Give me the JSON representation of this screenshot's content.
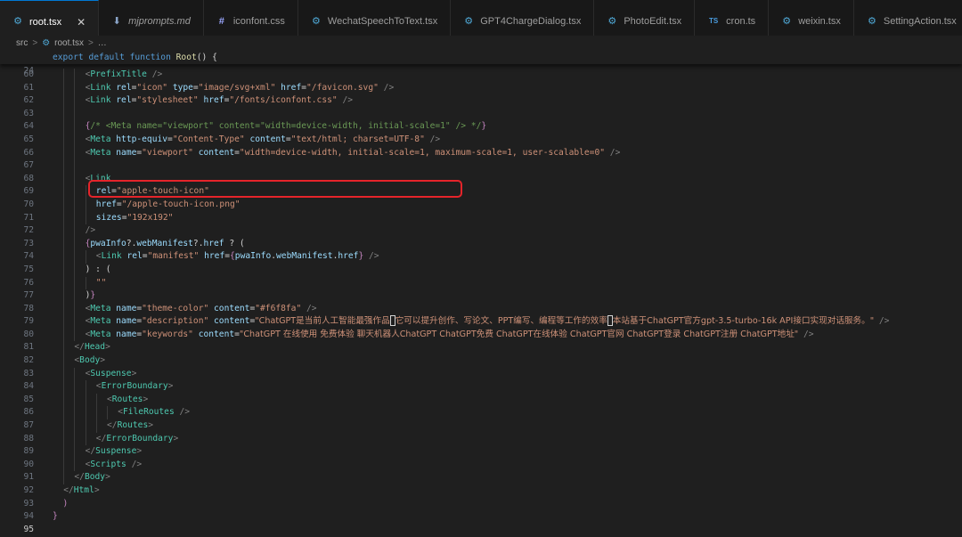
{
  "tabs": [
    {
      "label": "root.tsx",
      "icon": "react-gear-icon",
      "active": true
    },
    {
      "label": "mjprompts.md",
      "icon": "markdown-icon",
      "active": false,
      "italic": true
    },
    {
      "label": "iconfont.css",
      "icon": "css-hash-icon",
      "active": false
    },
    {
      "label": "WechatSpeechToText.tsx",
      "icon": "react-gear-icon",
      "active": false
    },
    {
      "label": "GPT4ChargeDialog.tsx",
      "icon": "react-gear-icon",
      "active": false
    },
    {
      "label": "PhotoEdit.tsx",
      "icon": "react-gear-icon",
      "active": false
    },
    {
      "label": "cron.ts",
      "icon": "typescript-icon",
      "active": false
    },
    {
      "label": "weixin.tsx",
      "icon": "react-gear-icon",
      "active": false
    },
    {
      "label": "SettingAction.tsx",
      "icon": "react-gear-icon",
      "active": false
    }
  ],
  "tab_icon_glyphs": {
    "react-gear-icon": "⚙",
    "markdown-icon": "⬇",
    "css-hash-icon": "#",
    "typescript-icon": "TS"
  },
  "tab_close_glyph": "✕",
  "breadcrumb": {
    "folder": "src",
    "file": "root.tsx",
    "ellipsis": "…",
    "separator": ">"
  },
  "sticky": {
    "line_number": "24",
    "tokens": [
      [
        "kw",
        "export"
      ],
      [
        "punct",
        " "
      ],
      [
        "kw",
        "default"
      ],
      [
        "punct",
        " "
      ],
      [
        "kw",
        "function"
      ],
      [
        "punct",
        " "
      ],
      [
        "fn",
        "Root"
      ],
      [
        "punct",
        "() {"
      ]
    ]
  },
  "current_line": "95",
  "highlighted_line": "65",
  "lines": [
    {
      "n": "60",
      "indent": 3,
      "tokens": [
        [
          "brk",
          "<"
        ],
        [
          "tag",
          "PrefixTitle"
        ],
        [
          "punct",
          " "
        ],
        [
          "brk",
          "/>"
        ]
      ]
    },
    {
      "n": "61",
      "indent": 3,
      "tokens": [
        [
          "brk",
          "<"
        ],
        [
          "tag",
          "Link"
        ],
        [
          "punct",
          " "
        ],
        [
          "attr",
          "rel"
        ],
        [
          "punct",
          "="
        ],
        [
          "str",
          "\"icon\""
        ],
        [
          "punct",
          " "
        ],
        [
          "attr",
          "type"
        ],
        [
          "punct",
          "="
        ],
        [
          "str",
          "\"image/svg+xml\""
        ],
        [
          "punct",
          " "
        ],
        [
          "attr",
          "href"
        ],
        [
          "punct",
          "="
        ],
        [
          "str",
          "\"/favicon.svg\""
        ],
        [
          "punct",
          " "
        ],
        [
          "brk",
          "/>"
        ]
      ]
    },
    {
      "n": "62",
      "indent": 3,
      "tokens": [
        [
          "brk",
          "<"
        ],
        [
          "tag",
          "Link"
        ],
        [
          "punct",
          " "
        ],
        [
          "attr",
          "rel"
        ],
        [
          "punct",
          "="
        ],
        [
          "str",
          "\"stylesheet\""
        ],
        [
          "punct",
          " "
        ],
        [
          "attr",
          "href"
        ],
        [
          "punct",
          "="
        ],
        [
          "str",
          "\"/fonts/iconfont.css\""
        ],
        [
          "punct",
          " "
        ],
        [
          "brk",
          "/>"
        ]
      ]
    },
    {
      "n": "63",
      "indent": 3,
      "tokens": []
    },
    {
      "n": "64",
      "indent": 3,
      "tokens": [
        [
          "ctl",
          "{"
        ],
        [
          "cmt",
          "/* <Meta name=\"viewport\" content=\"width=device-width, initial-scale=1\" /> */"
        ],
        [
          "ctl",
          "}"
        ]
      ]
    },
    {
      "n": "65",
      "indent": 3,
      "tokens": [
        [
          "brk",
          "<"
        ],
        [
          "tag",
          "Meta"
        ],
        [
          "punct",
          " "
        ],
        [
          "attr",
          "http-equiv"
        ],
        [
          "punct",
          "="
        ],
        [
          "str",
          "\"Content-Type\""
        ],
        [
          "punct",
          " "
        ],
        [
          "attr",
          "content"
        ],
        [
          "punct",
          "="
        ],
        [
          "str",
          "\"text/html; charset=UTF-8\""
        ],
        [
          "punct",
          " "
        ],
        [
          "brk",
          "/>"
        ]
      ]
    },
    {
      "n": "66",
      "indent": 3,
      "tokens": [
        [
          "brk",
          "<"
        ],
        [
          "tag",
          "Meta"
        ],
        [
          "punct",
          " "
        ],
        [
          "attr",
          "name"
        ],
        [
          "punct",
          "="
        ],
        [
          "str",
          "\"viewport\""
        ],
        [
          "punct",
          " "
        ],
        [
          "attr",
          "content"
        ],
        [
          "punct",
          "="
        ],
        [
          "str",
          "\"width=device-width, initial-scale=1, maximum-scale=1, user-scalable=0\""
        ],
        [
          "punct",
          " "
        ],
        [
          "brk",
          "/>"
        ]
      ]
    },
    {
      "n": "67",
      "indent": 3,
      "tokens": []
    },
    {
      "n": "68",
      "indent": 3,
      "tokens": [
        [
          "brk",
          "<"
        ],
        [
          "tag",
          "Link"
        ]
      ]
    },
    {
      "n": "69",
      "indent": 4,
      "tokens": [
        [
          "attr",
          "rel"
        ],
        [
          "punct",
          "="
        ],
        [
          "str",
          "\"apple-touch-icon\""
        ]
      ]
    },
    {
      "n": "70",
      "indent": 4,
      "tokens": [
        [
          "attr",
          "href"
        ],
        [
          "punct",
          "="
        ],
        [
          "str",
          "\"/apple-touch-icon.png\""
        ]
      ]
    },
    {
      "n": "71",
      "indent": 4,
      "tokens": [
        [
          "attr",
          "sizes"
        ],
        [
          "punct",
          "="
        ],
        [
          "str",
          "\"192x192\""
        ]
      ]
    },
    {
      "n": "72",
      "indent": 3,
      "tokens": [
        [
          "brk",
          "/>"
        ]
      ]
    },
    {
      "n": "73",
      "indent": 3,
      "tokens": [
        [
          "ctl",
          "{"
        ],
        [
          "var",
          "pwaInfo"
        ],
        [
          "punct",
          "?."
        ],
        [
          "prop",
          "webManifest"
        ],
        [
          "punct",
          "?."
        ],
        [
          "prop",
          "href"
        ],
        [
          "punct",
          " ? ("
        ]
      ]
    },
    {
      "n": "74",
      "indent": 4,
      "tokens": [
        [
          "brk",
          "<"
        ],
        [
          "tag",
          "Link"
        ],
        [
          "punct",
          " "
        ],
        [
          "attr",
          "rel"
        ],
        [
          "punct",
          "="
        ],
        [
          "str",
          "\"manifest\""
        ],
        [
          "punct",
          " "
        ],
        [
          "attr",
          "href"
        ],
        [
          "punct",
          "="
        ],
        [
          "ctl",
          "{"
        ],
        [
          "var",
          "pwaInfo"
        ],
        [
          "punct",
          "."
        ],
        [
          "prop",
          "webManifest"
        ],
        [
          "punct",
          "."
        ],
        [
          "prop",
          "href"
        ],
        [
          "ctl",
          "}"
        ],
        [
          "punct",
          " "
        ],
        [
          "brk",
          "/>"
        ]
      ]
    },
    {
      "n": "75",
      "indent": 3,
      "tokens": [
        [
          "punct",
          ") : ("
        ]
      ]
    },
    {
      "n": "76",
      "indent": 4,
      "tokens": [
        [
          "str",
          "\"\""
        ]
      ]
    },
    {
      "n": "77",
      "indent": 3,
      "tokens": [
        [
          "punct",
          ")"
        ],
        [
          "ctl",
          "}"
        ]
      ]
    },
    {
      "n": "78",
      "indent": 3,
      "tokens": [
        [
          "brk",
          "<"
        ],
        [
          "tag",
          "Meta"
        ],
        [
          "punct",
          " "
        ],
        [
          "attr",
          "name"
        ],
        [
          "punct",
          "="
        ],
        [
          "str",
          "\"theme-color\""
        ],
        [
          "punct",
          " "
        ],
        [
          "attr",
          "content"
        ],
        [
          "punct",
          "="
        ],
        [
          "str",
          "\"#f6f8fa\""
        ],
        [
          "punct",
          " "
        ],
        [
          "brk",
          "/>"
        ]
      ]
    },
    {
      "n": "79",
      "indent": 3,
      "tokens": [
        [
          "brk",
          "<"
        ],
        [
          "tag",
          "Meta"
        ],
        [
          "punct",
          " "
        ],
        [
          "attr",
          "name"
        ],
        [
          "punct",
          "="
        ],
        [
          "str",
          "\"description\""
        ],
        [
          "punct",
          " "
        ],
        [
          "attr",
          "content"
        ],
        [
          "punct",
          "="
        ],
        [
          "str",
          "\"ChatGPT是当前人工智能最强作品"
        ],
        [
          "cur",
          ""
        ],
        [
          "str",
          "它可以提升创作、写论文、PPT编写、编程等工作的效率"
        ],
        [
          "cur",
          ""
        ],
        [
          "str",
          "本站基于ChatGPT官方gpt-3.5-turbo-16k API接口实现对话服务。\""
        ],
        [
          "punct",
          " "
        ],
        [
          "brk",
          "/>"
        ]
      ]
    },
    {
      "n": "80",
      "indent": 3,
      "tokens": [
        [
          "brk",
          "<"
        ],
        [
          "tag",
          "Meta"
        ],
        [
          "punct",
          " "
        ],
        [
          "attr",
          "name"
        ],
        [
          "punct",
          "="
        ],
        [
          "str",
          "\"keywords\""
        ],
        [
          "punct",
          " "
        ],
        [
          "attr",
          "content"
        ],
        [
          "punct",
          "="
        ],
        [
          "str",
          "\"ChatGPT 在线使用 免费体验 聊天机器人ChatGPT ChatGPT免费 ChatGPT在线体验 ChatGPT官网 ChatGPT登录 ChatGPT注册 ChatGPT地址\""
        ],
        [
          "punct",
          " "
        ],
        [
          "brk",
          "/>"
        ]
      ]
    },
    {
      "n": "81",
      "indent": 2,
      "tokens": [
        [
          "brk",
          "</"
        ],
        [
          "tag",
          "Head"
        ],
        [
          "brk",
          ">"
        ]
      ]
    },
    {
      "n": "82",
      "indent": 2,
      "tokens": [
        [
          "brk",
          "<"
        ],
        [
          "tag",
          "Body"
        ],
        [
          "brk",
          ">"
        ]
      ]
    },
    {
      "n": "83",
      "indent": 3,
      "tokens": [
        [
          "brk",
          "<"
        ],
        [
          "tag",
          "Suspense"
        ],
        [
          "brk",
          ">"
        ]
      ]
    },
    {
      "n": "84",
      "indent": 4,
      "tokens": [
        [
          "brk",
          "<"
        ],
        [
          "tag",
          "ErrorBoundary"
        ],
        [
          "brk",
          ">"
        ]
      ]
    },
    {
      "n": "85",
      "indent": 5,
      "tokens": [
        [
          "brk",
          "<"
        ],
        [
          "tag",
          "Routes"
        ],
        [
          "brk",
          ">"
        ]
      ]
    },
    {
      "n": "86",
      "indent": 6,
      "tokens": [
        [
          "brk",
          "<"
        ],
        [
          "tag",
          "FileRoutes"
        ],
        [
          "punct",
          " "
        ],
        [
          "brk",
          "/>"
        ]
      ]
    },
    {
      "n": "87",
      "indent": 5,
      "tokens": [
        [
          "brk",
          "</"
        ],
        [
          "tag",
          "Routes"
        ],
        [
          "brk",
          ">"
        ]
      ]
    },
    {
      "n": "88",
      "indent": 4,
      "tokens": [
        [
          "brk",
          "</"
        ],
        [
          "tag",
          "ErrorBoundary"
        ],
        [
          "brk",
          ">"
        ]
      ]
    },
    {
      "n": "89",
      "indent": 3,
      "tokens": [
        [
          "brk",
          "</"
        ],
        [
          "tag",
          "Suspense"
        ],
        [
          "brk",
          ">"
        ]
      ]
    },
    {
      "n": "90",
      "indent": 3,
      "tokens": [
        [
          "brk",
          "<"
        ],
        [
          "tag",
          "Scripts"
        ],
        [
          "punct",
          " "
        ],
        [
          "brk",
          "/>"
        ]
      ]
    },
    {
      "n": "91",
      "indent": 2,
      "tokens": [
        [
          "brk",
          "</"
        ],
        [
          "tag",
          "Body"
        ],
        [
          "brk",
          ">"
        ]
      ]
    },
    {
      "n": "92",
      "indent": 1,
      "tokens": [
        [
          "brk",
          "</"
        ],
        [
          "tag",
          "Html"
        ],
        [
          "brk",
          ">"
        ]
      ]
    },
    {
      "n": "93",
      "indent": 0,
      "tokens": [
        [
          "ctl",
          "  )"
        ]
      ]
    },
    {
      "n": "94",
      "indent": 0,
      "tokens": [
        [
          "ctl",
          "}"
        ]
      ]
    },
    {
      "n": "95",
      "indent": 0,
      "tokens": []
    }
  ]
}
